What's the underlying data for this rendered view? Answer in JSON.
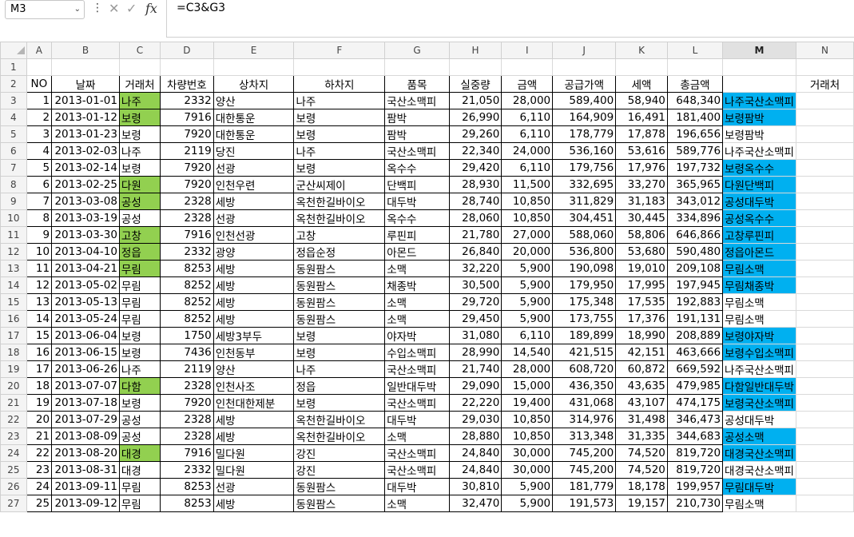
{
  "formula_bar": {
    "name_box": "M3",
    "fx": "fx",
    "cancel": "✕",
    "enter": "✓",
    "formula": "=C3&G3"
  },
  "columns": [
    "A",
    "B",
    "C",
    "D",
    "E",
    "F",
    "G",
    "H",
    "I",
    "J",
    "K",
    "L",
    "M",
    "N"
  ],
  "row2": [
    "NO",
    "날짜",
    "거래처",
    "차량번호",
    "상차지",
    "하차지",
    "품목",
    "실중량",
    "금액",
    "공급가액",
    "세액",
    "총금액",
    "",
    "거래처"
  ],
  "rows": [
    {
      "r": "3",
      "no": "1",
      "date": "2013-01-01",
      "client": "나주",
      "car": "2332",
      "load": "양산",
      "unload": "나주",
      "item": "국산소맥피",
      "weight": "21,050",
      "price": "28,000",
      "supply": "589,400",
      "tax": "58,940",
      "total": "648,340",
      "m": "나주국산소맥피",
      "c_green": true,
      "m_blue": true
    },
    {
      "r": "4",
      "no": "2",
      "date": "2013-01-12",
      "client": "보령",
      "car": "7916",
      "load": "대한통운",
      "unload": "보령",
      "item": "팜박",
      "weight": "26,990",
      "price": "6,110",
      "supply": "164,909",
      "tax": "16,491",
      "total": "181,400",
      "m": "보령팜박",
      "c_green": true,
      "m_blue": true
    },
    {
      "r": "5",
      "no": "3",
      "date": "2013-01-23",
      "client": "보령",
      "car": "7920",
      "load": "대한통운",
      "unload": "보령",
      "item": "팜박",
      "weight": "29,260",
      "price": "6,110",
      "supply": "178,779",
      "tax": "17,878",
      "total": "196,656",
      "m": "보령팜박",
      "c_green": false,
      "m_blue": false
    },
    {
      "r": "6",
      "no": "4",
      "date": "2013-02-03",
      "client": "나주",
      "car": "2119",
      "load": "당진",
      "unload": "나주",
      "item": "국산소맥피",
      "weight": "22,340",
      "price": "24,000",
      "supply": "536,160",
      "tax": "53,616",
      "total": "589,776",
      "m": "나주국산소맥피",
      "c_green": false,
      "m_blue": false
    },
    {
      "r": "7",
      "no": "5",
      "date": "2013-02-14",
      "client": "보령",
      "car": "7920",
      "load": "선광",
      "unload": "보령",
      "item": "옥수수",
      "weight": "29,420",
      "price": "6,110",
      "supply": "179,756",
      "tax": "17,976",
      "total": "197,732",
      "m": "보령옥수수",
      "c_green": false,
      "m_blue": true
    },
    {
      "r": "8",
      "no": "6",
      "date": "2013-02-25",
      "client": "다원",
      "car": "7920",
      "load": "인천우련",
      "unload": "군산씨제이",
      "item": "단백피",
      "weight": "28,930",
      "price": "11,500",
      "supply": "332,695",
      "tax": "33,270",
      "total": "365,965",
      "m": "다원단백피",
      "c_green": true,
      "m_blue": true
    },
    {
      "r": "9",
      "no": "7",
      "date": "2013-03-08",
      "client": "공성",
      "car": "2328",
      "load": "세방",
      "unload": "옥천한길바이오",
      "item": "대두박",
      "weight": "28,740",
      "price": "10,850",
      "supply": "311,829",
      "tax": "31,183",
      "total": "343,012",
      "m": "공성대두박",
      "c_green": true,
      "m_blue": true
    },
    {
      "r": "10",
      "no": "8",
      "date": "2013-03-19",
      "client": "공성",
      "car": "2328",
      "load": "선광",
      "unload": "옥천한길바이오",
      "item": "옥수수",
      "weight": "28,060",
      "price": "10,850",
      "supply": "304,451",
      "tax": "30,445",
      "total": "334,896",
      "m": "공성옥수수",
      "c_green": false,
      "m_blue": true
    },
    {
      "r": "11",
      "no": "9",
      "date": "2013-03-30",
      "client": "고창",
      "car": "7916",
      "load": "인천선광",
      "unload": "고창",
      "item": "루핀피",
      "weight": "21,780",
      "price": "27,000",
      "supply": "588,060",
      "tax": "58,806",
      "total": "646,866",
      "m": "고창루핀피",
      "c_green": true,
      "m_blue": true
    },
    {
      "r": "12",
      "no": "10",
      "date": "2013-04-10",
      "client": "정읍",
      "car": "2332",
      "load": "광양",
      "unload": "정읍순정",
      "item": "아몬드",
      "weight": "26,840",
      "price": "20,000",
      "supply": "536,800",
      "tax": "53,680",
      "total": "590,480",
      "m": "정읍아몬드",
      "c_green": true,
      "m_blue": true
    },
    {
      "r": "13",
      "no": "11",
      "date": "2013-04-21",
      "client": "무림",
      "car": "8253",
      "load": "세방",
      "unload": "동원팜스",
      "item": "소맥",
      "weight": "32,220",
      "price": "5,900",
      "supply": "190,098",
      "tax": "19,010",
      "total": "209,108",
      "m": "무림소맥",
      "c_green": true,
      "m_blue": true
    },
    {
      "r": "14",
      "no": "12",
      "date": "2013-05-02",
      "client": "무림",
      "car": "8252",
      "load": "세방",
      "unload": "동원팜스",
      "item": "채종박",
      "weight": "30,500",
      "price": "5,900",
      "supply": "179,950",
      "tax": "17,995",
      "total": "197,945",
      "m": "무림채종박",
      "c_green": false,
      "m_blue": true
    },
    {
      "r": "15",
      "no": "13",
      "date": "2013-05-13",
      "client": "무림",
      "car": "8252",
      "load": "세방",
      "unload": "동원팜스",
      "item": "소맥",
      "weight": "29,720",
      "price": "5,900",
      "supply": "175,348",
      "tax": "17,535",
      "total": "192,883",
      "m": "무림소맥",
      "c_green": false,
      "m_blue": false
    },
    {
      "r": "16",
      "no": "14",
      "date": "2013-05-24",
      "client": "무림",
      "car": "8252",
      "load": "세방",
      "unload": "동원팜스",
      "item": "소맥",
      "weight": "29,450",
      "price": "5,900",
      "supply": "173,755",
      "tax": "17,376",
      "total": "191,131",
      "m": "무림소맥",
      "c_green": false,
      "m_blue": false
    },
    {
      "r": "17",
      "no": "15",
      "date": "2013-06-04",
      "client": "보령",
      "car": "1750",
      "load": "세방3부두",
      "unload": "보령",
      "item": "야자박",
      "weight": "31,080",
      "price": "6,110",
      "supply": "189,899",
      "tax": "18,990",
      "total": "208,889",
      "m": "보령야자박",
      "c_green": false,
      "m_blue": true
    },
    {
      "r": "18",
      "no": "16",
      "date": "2013-06-15",
      "client": "보령",
      "car": "7436",
      "load": "인천동부",
      "unload": "보령",
      "item": "수입소맥피",
      "weight": "28,990",
      "price": "14,540",
      "supply": "421,515",
      "tax": "42,151",
      "total": "463,666",
      "m": "보령수입소맥피",
      "c_green": false,
      "m_blue": true
    },
    {
      "r": "19",
      "no": "17",
      "date": "2013-06-26",
      "client": "나주",
      "car": "2119",
      "load": "양산",
      "unload": "나주",
      "item": "국산소맥피",
      "weight": "21,740",
      "price": "28,000",
      "supply": "608,720",
      "tax": "60,872",
      "total": "669,592",
      "m": "나주국산소맥피",
      "c_green": false,
      "m_blue": false
    },
    {
      "r": "20",
      "no": "18",
      "date": "2013-07-07",
      "client": "다함",
      "car": "2328",
      "load": "인천사조",
      "unload": "정읍",
      "item": "일반대두박",
      "weight": "29,090",
      "price": "15,000",
      "supply": "436,350",
      "tax": "43,635",
      "total": "479,985",
      "m": "다함일반대두박",
      "c_green": true,
      "m_blue": true
    },
    {
      "r": "21",
      "no": "19",
      "date": "2013-07-18",
      "client": "보령",
      "car": "7920",
      "load": "인천대한제분",
      "unload": "보령",
      "item": "국산소맥피",
      "weight": "22,220",
      "price": "19,400",
      "supply": "431,068",
      "tax": "43,107",
      "total": "474,175",
      "m": "보령국산소맥피",
      "c_green": false,
      "m_blue": true
    },
    {
      "r": "22",
      "no": "20",
      "date": "2013-07-29",
      "client": "공성",
      "car": "2328",
      "load": "세방",
      "unload": "옥천한길바이오",
      "item": "대두박",
      "weight": "29,030",
      "price": "10,850",
      "supply": "314,976",
      "tax": "31,498",
      "total": "346,473",
      "m": "공성대두박",
      "c_green": false,
      "m_blue": false
    },
    {
      "r": "23",
      "no": "21",
      "date": "2013-08-09",
      "client": "공성",
      "car": "2328",
      "load": "세방",
      "unload": "옥천한길바이오",
      "item": "소맥",
      "weight": "28,880",
      "price": "10,850",
      "supply": "313,348",
      "tax": "31,335",
      "total": "344,683",
      "m": "공성소맥",
      "c_green": false,
      "m_blue": true
    },
    {
      "r": "24",
      "no": "22",
      "date": "2013-08-20",
      "client": "대경",
      "car": "7916",
      "load": "밀다원",
      "unload": "강진",
      "item": "국산소맥피",
      "weight": "24,840",
      "price": "30,000",
      "supply": "745,200",
      "tax": "74,520",
      "total": "819,720",
      "m": "대경국산소맥피",
      "c_green": true,
      "m_blue": true
    },
    {
      "r": "25",
      "no": "23",
      "date": "2013-08-31",
      "client": "대경",
      "car": "2332",
      "load": "밀다원",
      "unload": "강진",
      "item": "국산소맥피",
      "weight": "24,840",
      "price": "30,000",
      "supply": "745,200",
      "tax": "74,520",
      "total": "819,720",
      "m": "대경국산소맥피",
      "c_green": false,
      "m_blue": false
    },
    {
      "r": "26",
      "no": "24",
      "date": "2013-09-11",
      "client": "무림",
      "car": "8253",
      "load": "선광",
      "unload": "동원팜스",
      "item": "대두박",
      "weight": "30,810",
      "price": "5,900",
      "supply": "181,779",
      "tax": "18,178",
      "total": "199,957",
      "m": "무림대두박",
      "c_green": false,
      "m_blue": true
    },
    {
      "r": "27",
      "no": "25",
      "date": "2013-09-12",
      "client": "무림",
      "car": "8253",
      "load": "세방",
      "unload": "동원팜스",
      "item": "소맥",
      "weight": "32,470",
      "price": "5,900",
      "supply": "191,573",
      "tax": "19,157",
      "total": "210,730",
      "m": "무림소맥",
      "c_green": false,
      "m_blue": false
    }
  ]
}
